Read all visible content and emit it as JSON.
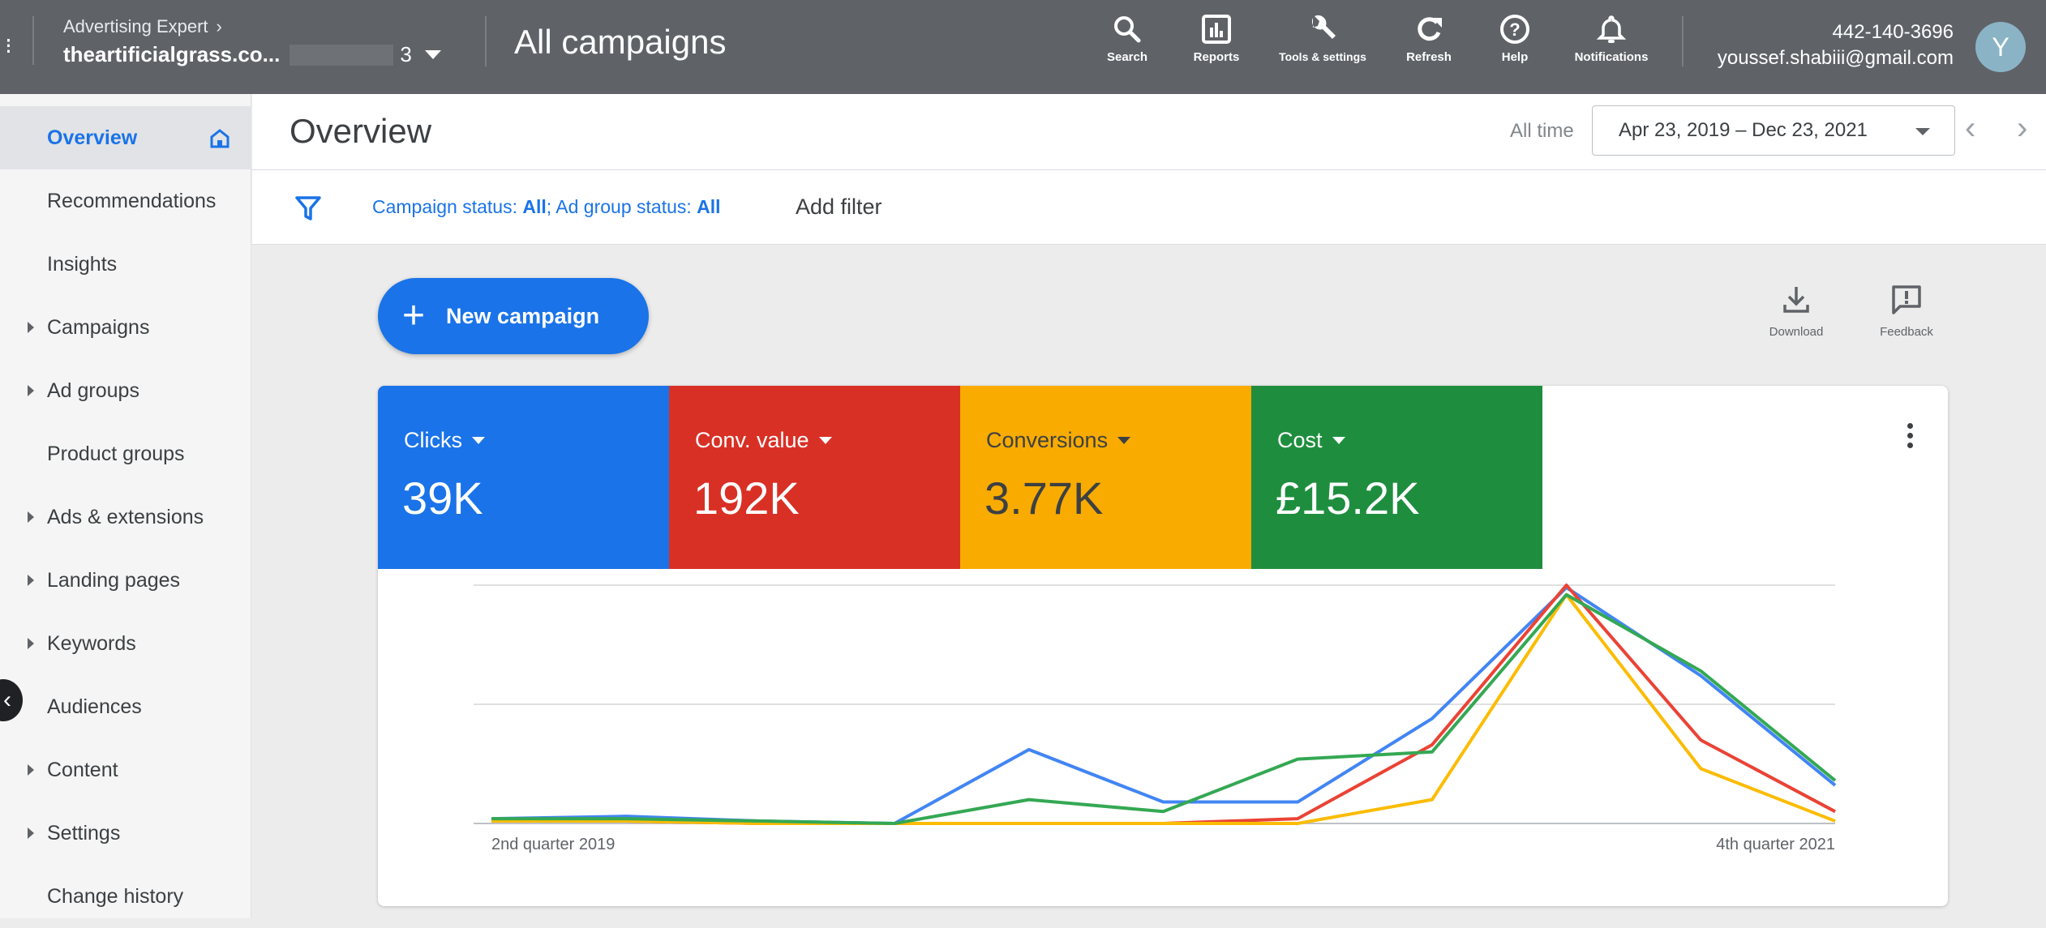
{
  "topbar": {
    "account_path": "Advertising Expert",
    "account_name": "theartificialgrass.co...",
    "account_id_tail": "3",
    "page_title": "All campaigns",
    "tools": [
      {
        "label": "Search",
        "icon": "search-icon"
      },
      {
        "label": "Reports",
        "icon": "reports-icon"
      },
      {
        "label": "Tools & settings",
        "icon": "wrench-icon"
      },
      {
        "label": "Refresh",
        "icon": "refresh-icon"
      },
      {
        "label": "Help",
        "icon": "help-icon"
      },
      {
        "label": "Notifications",
        "icon": "bell-icon"
      }
    ],
    "phone": "442-140-3696",
    "email": "youssef.shabiii@gmail.com",
    "avatar_initial": "Y"
  },
  "sidebar": {
    "items": [
      {
        "label": "Overview",
        "active": true,
        "expandable": false
      },
      {
        "label": "Recommendations",
        "expandable": false
      },
      {
        "label": "Insights",
        "expandable": false
      },
      {
        "label": "Campaigns",
        "expandable": true
      },
      {
        "label": "Ad groups",
        "expandable": true
      },
      {
        "label": "Product groups",
        "expandable": false
      },
      {
        "label": "Ads & extensions",
        "expandable": true
      },
      {
        "label": "Landing pages",
        "expandable": true
      },
      {
        "label": "Keywords",
        "expandable": true
      },
      {
        "label": "Audiences",
        "expandable": false
      },
      {
        "label": "Content",
        "expandable": true
      },
      {
        "label": "Settings",
        "expandable": true
      },
      {
        "label": "Change history",
        "expandable": false
      }
    ]
  },
  "header": {
    "title": "Overview",
    "range_label": "All time",
    "date_range": "Apr 23, 2019 – Dec 23, 2021"
  },
  "filters": {
    "campaign_status_label": "Campaign status: ",
    "campaign_status_value": "All",
    "ad_group_status_label": "; Ad group status: ",
    "ad_group_status_value": "All",
    "add_filter": "Add filter"
  },
  "actions": {
    "new_campaign": "New campaign",
    "download": "Download",
    "feedback": "Feedback"
  },
  "metrics": [
    {
      "label": "Clicks",
      "value": "39K",
      "color": "#1a73e8",
      "text_color": "#ffffff"
    },
    {
      "label": "Conv. value",
      "value": "192K",
      "color": "#d93025",
      "text_color": "#ffffff"
    },
    {
      "label": "Conversions",
      "value": "3.77K",
      "color": "#f9ab00",
      "text_color": "#3c4043"
    },
    {
      "label": "Cost",
      "value": "£15.2K",
      "color": "#1e8e3e",
      "text_color": "#ffffff"
    }
  ],
  "chart_data": {
    "type": "line",
    "x": [
      "2nd quarter 2019",
      "3rd quarter 2019",
      "4th quarter 2019",
      "1st quarter 2020",
      "2nd quarter 2020",
      "3rd quarter 2020",
      "4th quarter 2020",
      "1st quarter 2021",
      "2nd quarter 2021",
      "3rd quarter 2021",
      "4th quarter 2021"
    ],
    "x_tick_labels": [
      "2nd quarter 2019",
      "4th quarter 2021"
    ],
    "ylim": [
      0,
      100
    ],
    "grid": true,
    "series": [
      {
        "name": "Clicks",
        "color": "#4285f4",
        "values": [
          2,
          3,
          1,
          0,
          31,
          9,
          9,
          44,
          99,
          62,
          16
        ]
      },
      {
        "name": "Conv. value",
        "color": "#ea4335",
        "values": [
          1,
          1,
          0,
          0,
          0,
          0,
          2,
          33,
          100,
          35,
          5
        ]
      },
      {
        "name": "Conversions",
        "color": "#fbbc04",
        "values": [
          1,
          1,
          0,
          0,
          0,
          0,
          0,
          10,
          96,
          23,
          1
        ]
      },
      {
        "name": "Cost",
        "color": "#34a853",
        "values": [
          2,
          2,
          1,
          0,
          10,
          5,
          27,
          30,
          96,
          64,
          18
        ]
      }
    ]
  }
}
